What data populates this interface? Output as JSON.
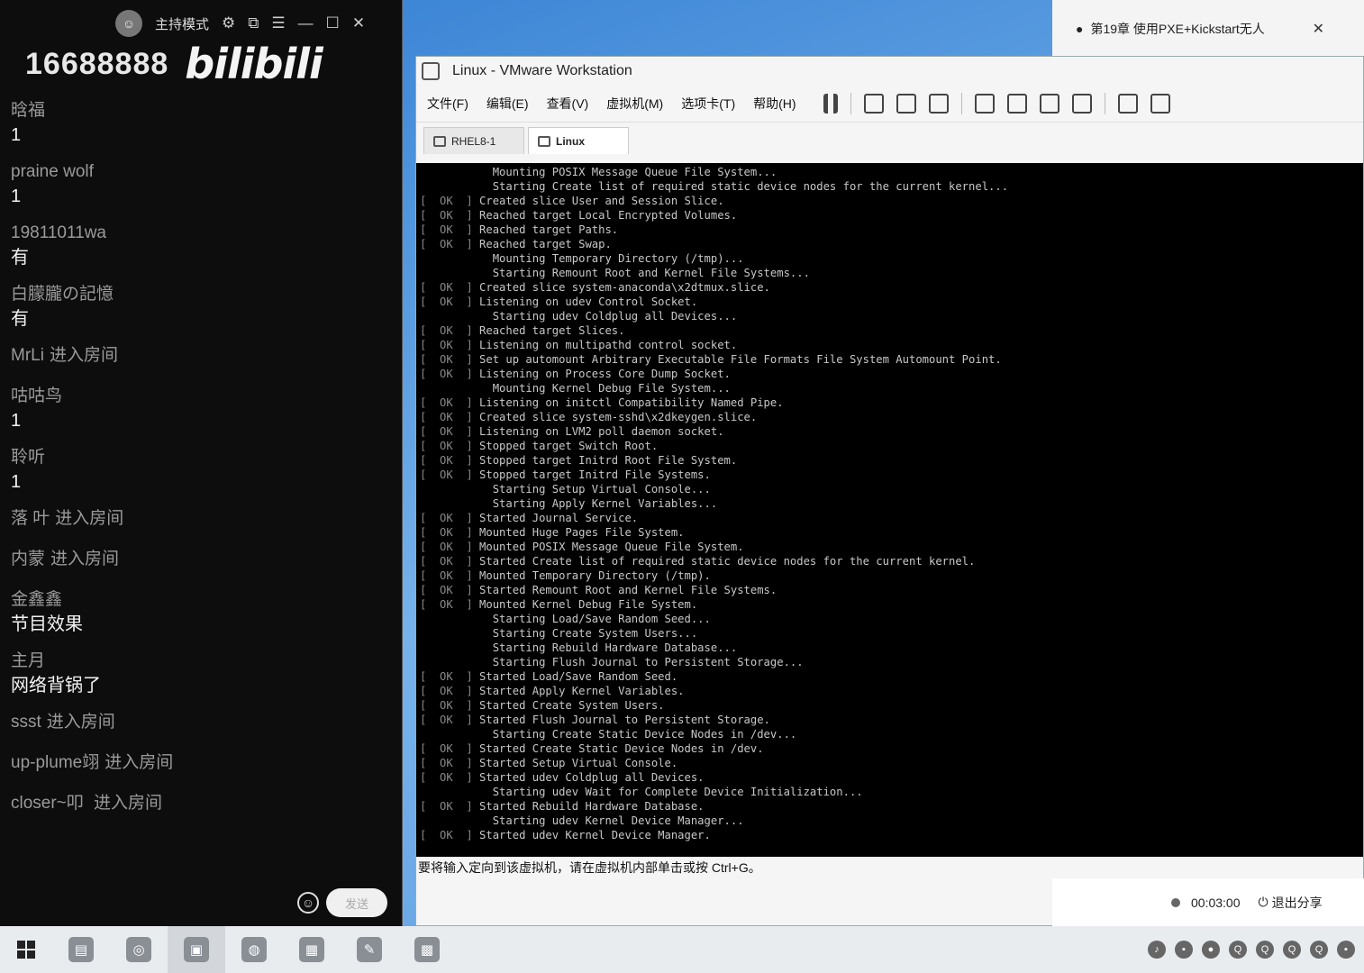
{
  "chat": {
    "host_mode": "主持模式",
    "room_id": "16688888",
    "brand": "bilibili",
    "messages": [
      {
        "type": "msg",
        "user": "晗福",
        "text": "1"
      },
      {
        "type": "msg",
        "user": "praine wolf",
        "text": "1"
      },
      {
        "type": "msg",
        "user": "19811011wa",
        "text": "有"
      },
      {
        "type": "msg",
        "user": "白朦朧の記憶",
        "text": "有"
      },
      {
        "type": "enter",
        "user": "MrLi",
        "action": "进入房间"
      },
      {
        "type": "msg",
        "user": "咕咕鸟",
        "text": "1"
      },
      {
        "type": "msg",
        "user": "聆听",
        "text": "1"
      },
      {
        "type": "enter",
        "user": "   落    叶",
        "action": "进入房间"
      },
      {
        "type": "enter",
        "user": "内蒙",
        "action": "进入房间"
      },
      {
        "type": "msg",
        "user": "金鑫鑫",
        "text": "节目效果"
      },
      {
        "type": "msg",
        "user": "主月",
        "text": "网络背锅了"
      },
      {
        "type": "enter",
        "user": "ssst",
        "action": "进入房间"
      },
      {
        "type": "enter",
        "user": "up-plume翊",
        "action": "进入房间"
      },
      {
        "type": "enter",
        "user": "closer~叩",
        "action": "   进入房间"
      }
    ],
    "send_label": "发送"
  },
  "browser_tab": {
    "title": "第19章 使用PXE+Kickstart无人"
  },
  "vmware": {
    "title": "Linux - VMware Workstation",
    "menu": [
      "文件(F)",
      "编辑(E)",
      "查看(V)",
      "虚拟机(M)",
      "选项卡(T)",
      "帮助(H)"
    ],
    "tabs": [
      {
        "label": "RHEL8-1",
        "active": false
      },
      {
        "label": "Linux",
        "active": true
      }
    ],
    "status_text": "要将输入定向到该虚拟机，请在虚拟机内部单击或按 Ctrl+G。",
    "console_lines": [
      {
        "status": "",
        "text": "Mounting POSIX Message Queue File System..."
      },
      {
        "status": "",
        "text": "Starting Create list of required static device nodes for the current kernel..."
      },
      {
        "status": "OK",
        "text": "Created slice User and Session Slice."
      },
      {
        "status": "OK",
        "text": "Reached target Local Encrypted Volumes."
      },
      {
        "status": "OK",
        "text": "Reached target Paths."
      },
      {
        "status": "OK",
        "text": "Reached target Swap."
      },
      {
        "status": "",
        "text": "Mounting Temporary Directory (/tmp)..."
      },
      {
        "status": "",
        "text": "Starting Remount Root and Kernel File Systems..."
      },
      {
        "status": "OK",
        "text": "Created slice system-anaconda\\x2dtmux.slice."
      },
      {
        "status": "OK",
        "text": "Listening on udev Control Socket."
      },
      {
        "status": "",
        "text": "Starting udev Coldplug all Devices..."
      },
      {
        "status": "OK",
        "text": "Reached target Slices."
      },
      {
        "status": "OK",
        "text": "Listening on multipathd control socket."
      },
      {
        "status": "OK",
        "text": "Set up automount Arbitrary Executable File Formats File System Automount Point."
      },
      {
        "status": "OK",
        "text": "Listening on Process Core Dump Socket."
      },
      {
        "status": "",
        "text": "Mounting Kernel Debug File System..."
      },
      {
        "status": "OK",
        "text": "Listening on initctl Compatibility Named Pipe."
      },
      {
        "status": "OK",
        "text": "Created slice system-sshd\\x2dkeygen.slice."
      },
      {
        "status": "OK",
        "text": "Listening on LVM2 poll daemon socket."
      },
      {
        "status": "OK",
        "text": "Stopped target Switch Root."
      },
      {
        "status": "OK",
        "text": "Stopped target Initrd Root File System."
      },
      {
        "status": "OK",
        "text": "Stopped target Initrd File Systems."
      },
      {
        "status": "",
        "text": "Starting Setup Virtual Console..."
      },
      {
        "status": "",
        "text": "Starting Apply Kernel Variables..."
      },
      {
        "status": "OK",
        "text": "Started Journal Service."
      },
      {
        "status": "OK",
        "text": "Mounted Huge Pages File System."
      },
      {
        "status": "OK",
        "text": "Mounted POSIX Message Queue File System."
      },
      {
        "status": "OK",
        "text": "Started Create list of required static device nodes for the current kernel."
      },
      {
        "status": "OK",
        "text": "Mounted Temporary Directory (/tmp)."
      },
      {
        "status": "OK",
        "text": "Started Remount Root and Kernel File Systems."
      },
      {
        "status": "OK",
        "text": "Mounted Kernel Debug File System."
      },
      {
        "status": "",
        "text": "Starting Load/Save Random Seed..."
      },
      {
        "status": "",
        "text": "Starting Create System Users..."
      },
      {
        "status": "",
        "text": "Starting Rebuild Hardware Database..."
      },
      {
        "status": "",
        "text": "Starting Flush Journal to Persistent Storage..."
      },
      {
        "status": "OK",
        "text": "Started Load/Save Random Seed."
      },
      {
        "status": "OK",
        "text": "Started Apply Kernel Variables."
      },
      {
        "status": "OK",
        "text": "Started Create System Users."
      },
      {
        "status": "OK",
        "text": "Started Flush Journal to Persistent Storage."
      },
      {
        "status": "",
        "text": "Starting Create Static Device Nodes in /dev..."
      },
      {
        "status": "OK",
        "text": "Started Create Static Device Nodes in /dev."
      },
      {
        "status": "OK",
        "text": "Started Setup Virtual Console."
      },
      {
        "status": "OK",
        "text": "Started udev Coldplug all Devices."
      },
      {
        "status": "",
        "text": "Starting udev Wait for Complete Device Initialization..."
      },
      {
        "status": "OK",
        "text": "Started Rebuild Hardware Database."
      },
      {
        "status": "",
        "text": "Starting udev Kernel Device Manager..."
      },
      {
        "status": "OK",
        "text": "Started udev Kernel Device Manager."
      }
    ]
  },
  "share": {
    "timer": "00:03:00",
    "exit_label": "退出分享"
  }
}
